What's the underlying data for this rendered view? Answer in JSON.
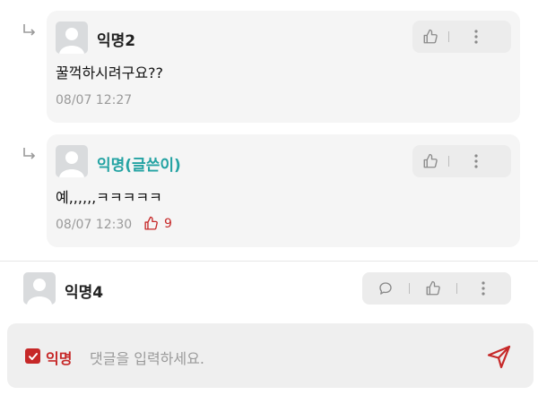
{
  "comments": [
    {
      "author": "익명2",
      "is_writer": false,
      "content": "꿀꺽하시려구요??",
      "time": "08/07 12:27",
      "likes": null
    },
    {
      "author": "익명(글쓴이)",
      "is_writer": true,
      "content": "예,,,,,,ㅋㅋㅋㅋㅋ",
      "time": "08/07 12:30",
      "likes": "9"
    },
    {
      "author": "익명4",
      "is_writer": false
    }
  ],
  "input_bar": {
    "anonymous_label": "익명",
    "anonymous_checked": true,
    "placeholder": "댓글을 입력하세요."
  },
  "icons": {
    "reply": "reply-arrow-icon",
    "like": "thumbs-up-icon",
    "more": "more-vertical-icon",
    "comment": "speech-bubble-icon",
    "send": "send-icon",
    "avatar": "default-avatar-icon"
  },
  "colors": {
    "accent_red": "#c62828",
    "writer_teal": "#24a3a3",
    "card_bg": "#f5f5f5",
    "meta_gray": "#9a9a9a"
  }
}
